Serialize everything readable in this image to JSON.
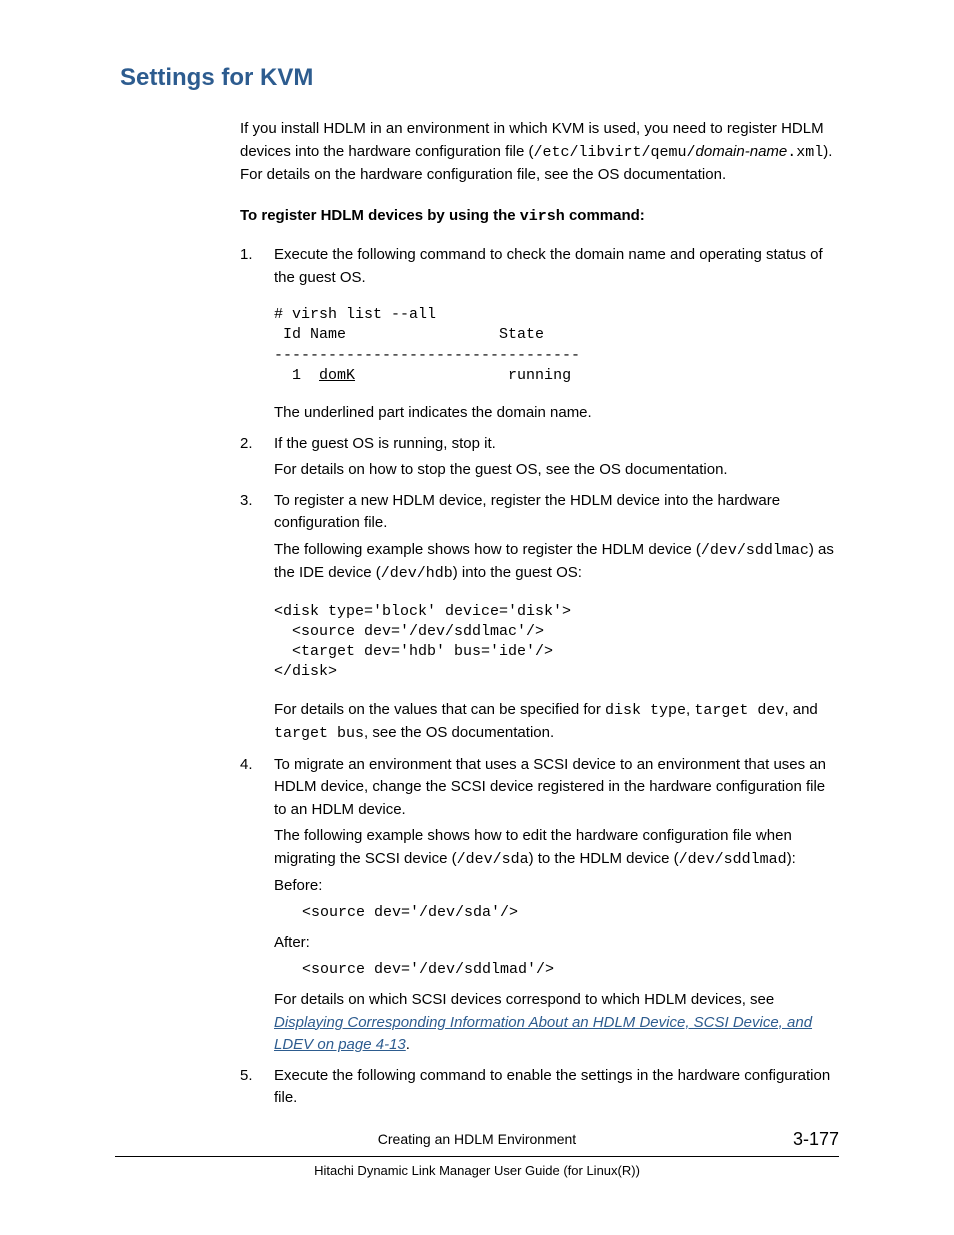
{
  "heading": "Settings for KVM",
  "intro": {
    "p1_a": "If you install HDLM in an environment in which KVM is used, you need to register HDLM devices into the hardware configuration file (",
    "p1_code1": "/etc/libvirt/qemu/",
    "p1_italic": "domain-name",
    "p1_code2": ".xml",
    "p1_b": "). For details on the hardware configuration file, see the OS documentation."
  },
  "subhead": {
    "a": "To register HDLM devices by using the ",
    "code": "virsh",
    "b": " command:"
  },
  "steps": {
    "s1": {
      "num": "1.",
      "p1": "Execute the following command to check the domain name and operating status of the guest OS.",
      "code_l1": "# virsh list --all",
      "code_l2": " Id Name                 State",
      "code_l3": "----------------------------------",
      "code_l4a": "  1  ",
      "code_l4_u": "domK",
      "code_l4b": "                 running",
      "p2": "The underlined part indicates the domain name."
    },
    "s2": {
      "num": "2.",
      "p1": "If the guest OS is running, stop it.",
      "p2": "For details on how to stop the guest OS, see the OS documentation."
    },
    "s3": {
      "num": "3.",
      "p1": "To register a new HDLM device, register the HDLM device into the hardware configuration file.",
      "p2_a": "The following example shows how to register the HDLM device (",
      "p2_code1": "/dev/sddlmac",
      "p2_b": ") as the IDE device (",
      "p2_code2": "/dev/hdb",
      "p2_c": ") into the guest OS:",
      "code": "<disk type='block' device='disk'>\n  <source dev='/dev/sddlmac'/>\n  <target dev='hdb' bus='ide'/>\n</disk>",
      "p3_a": "For details on the values that can be specified for ",
      "p3_code1": "disk type",
      "p3_b": ", ",
      "p3_code2": "target dev",
      "p3_c": ", and ",
      "p3_code3": "target bus",
      "p3_d": ", see the OS documentation."
    },
    "s4": {
      "num": "4.",
      "p1": "To migrate an environment that uses a SCSI device to an environment that uses an HDLM device, change the SCSI device registered in the hardware configuration file to an HDLM device.",
      "p2_a": "The following example shows how to edit the hardware configuration file when migrating the SCSI device (",
      "p2_code1": "/dev/sda",
      "p2_b": ") to the HDLM device (",
      "p2_code2": "/dev/sddlmad",
      "p2_c": "):",
      "before_label": "Before:",
      "before_code": "<source dev='/dev/sda'/>",
      "after_label": "After:",
      "after_code": "<source dev='/dev/sddlmad'/>",
      "p3_a": "For details on which SCSI devices correspond to which HDLM devices, see ",
      "p3_link": "Displaying Corresponding Information About an HDLM Device, SCSI Device, and LDEV on page 4-13",
      "p3_b": "."
    },
    "s5": {
      "num": "5.",
      "p1": "Execute the following command to enable the settings in the hardware configuration file."
    }
  },
  "footer": {
    "line1": "Creating an HDLM Environment",
    "pagenum": "3-177",
    "line2": "Hitachi Dynamic Link Manager User Guide (for Linux(R))"
  }
}
